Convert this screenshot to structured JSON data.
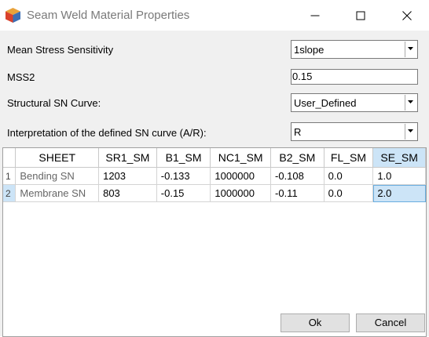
{
  "window": {
    "title": "Seam Weld Material Properties",
    "icon": "hypermesh-cube-icon"
  },
  "form": {
    "mean_stress_label": "Mean Stress Sensitivity",
    "mean_stress_value": "1slope",
    "mss2_label": "MSS2",
    "mss2_value": "0.15",
    "sn_curve_label": "Structural SN Curve:",
    "sn_curve_value": "User_Defined",
    "interpretation_label": "Interpretation of the defined SN curve (A/R):",
    "interpretation_value": "R"
  },
  "table": {
    "columns": [
      "SHEET",
      "SR1_SM",
      "B1_SM",
      "NC1_SM",
      "B2_SM",
      "FL_SM",
      "SE_SM"
    ],
    "selected_column": "SE_SM",
    "rows": [
      {
        "num": "1",
        "cells": [
          "Bending SN",
          "1203",
          "-0.133",
          "1000000",
          "-0.108",
          "0.0",
          "1.0"
        ]
      },
      {
        "num": "2",
        "cells": [
          "Membrane SN",
          "803",
          "-0.15",
          "1000000",
          "-0.11",
          "0.0",
          "2.0"
        ]
      }
    ]
  },
  "buttons": {
    "ok": "Ok",
    "cancel": "Cancel"
  }
}
